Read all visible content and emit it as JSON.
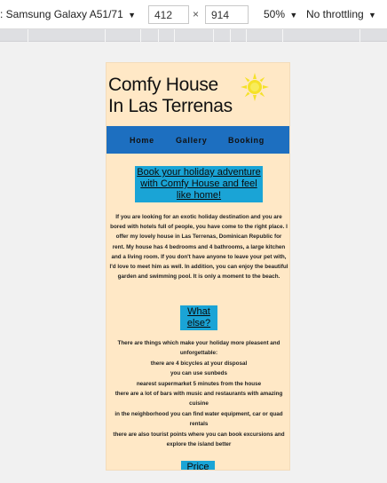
{
  "devtools": {
    "device_label": ": Samsung Galaxy A51/71",
    "width_value": "412",
    "height_value": "914",
    "times": "×",
    "zoom_label": "50%",
    "throttle_label": "No throttling",
    "caret": "▼"
  },
  "page": {
    "title_line1": "Comfy House",
    "title_line2": "In Las Terrenas",
    "sun_color": "#f5e12a",
    "nav": {
      "home": "Home",
      "gallery": "Gallery",
      "booking": "Booking"
    },
    "intro_heading": "Book your holiday adventure with Comfy House and feel like home!",
    "intro_text": "If you are looking for an exotic holiday destination and you are bored with hotels full of people, you have come to the right place. I offer my lovely house in Las Terrenas, Dominican Republic for rent. My house has 4 bedrooms and 4 bathrooms, a large kitchen and a living room. If you don't have anyone to leave your pet with, I'd love to meet him as well. In addition, you can enjoy the beautiful garden and swimming pool. It is only a moment to the beach.",
    "what_else_heading": "What else?",
    "list_intro": "There are things which make your holiday more pleasent and unforgettable:",
    "list_items": [
      "there are 4 bicycles at your disposal",
      "you can use sunbeds",
      "nearest supermarket 5 minutes from the house",
      "there are a lot of bars with music and restaurants with amazing cuisine",
      "in the neighborhood you can find water equipment, car or quad rentals",
      "there are also tourist points where you can book excursions and explore the island better"
    ],
    "price_heading": "Price"
  },
  "colors": {
    "page_background": "#ffe8c6",
    "nav_background": "#1d6fc0",
    "heading_background": "#1aa4d6"
  }
}
